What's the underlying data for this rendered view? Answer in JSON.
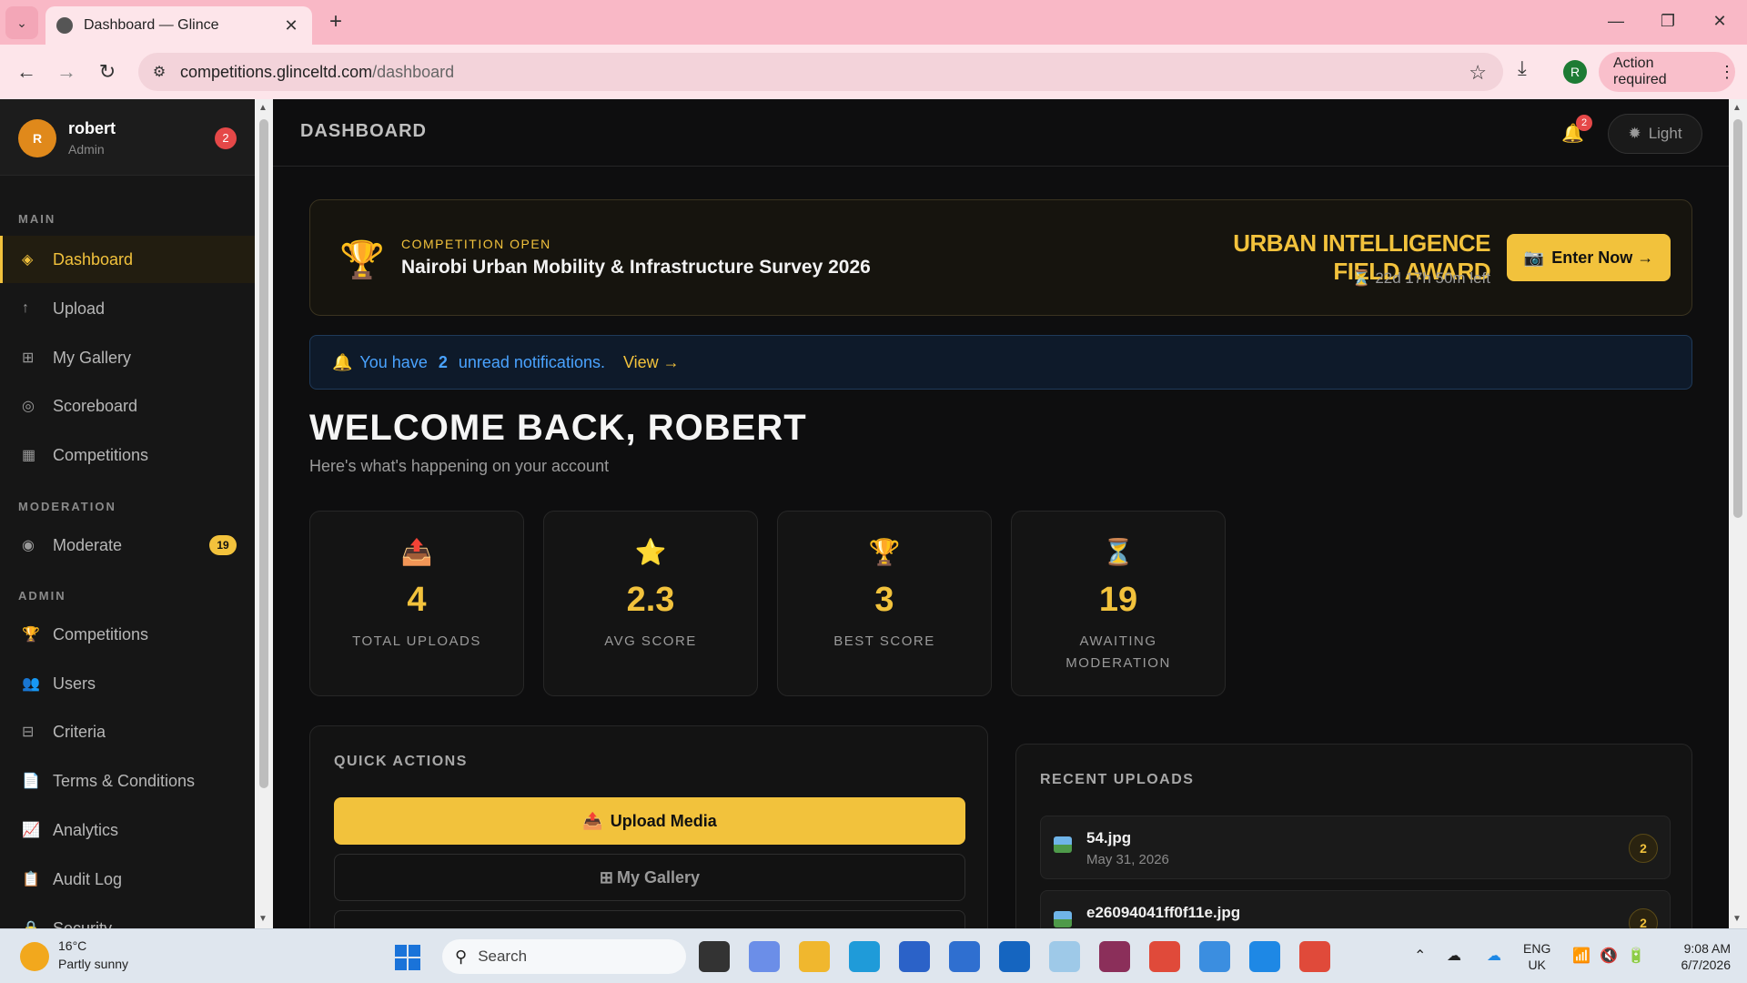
{
  "browser": {
    "tab_title": "Dashboard — Glince",
    "url_host": "competitions.glinceltd.com",
    "url_path": "/dashboard",
    "profile_initial": "R",
    "action_required": "Action required"
  },
  "sidebar": {
    "user": {
      "initial": "R",
      "name": "robert",
      "role": "Admin",
      "badge": "2"
    },
    "sections": {
      "main": "MAIN",
      "moderation": "MODERATION",
      "admin": "ADMIN"
    },
    "items": [
      {
        "label": "Dashboard",
        "icon": "diamond-icon",
        "glyph": "◈"
      },
      {
        "label": "Upload",
        "icon": "arrow-up-icon",
        "glyph": "↑"
      },
      {
        "label": "My Gallery",
        "icon": "grid-icon",
        "glyph": "⊞"
      },
      {
        "label": "Scoreboard",
        "icon": "target-icon",
        "glyph": "◎"
      },
      {
        "label": "Competitions",
        "icon": "checkered-flag-icon",
        "glyph": "▦"
      },
      {
        "label": "Moderate",
        "icon": "radio-icon",
        "glyph": "◉",
        "badge": "19"
      },
      {
        "label": "Competitions",
        "icon": "trophy-icon",
        "glyph": "🏆"
      },
      {
        "label": "Users",
        "icon": "users-icon",
        "glyph": "👥"
      },
      {
        "label": "Criteria",
        "icon": "list-icon",
        "glyph": "⊟"
      },
      {
        "label": "Terms & Conditions",
        "icon": "document-icon",
        "glyph": "📄"
      },
      {
        "label": "Analytics",
        "icon": "chart-icon",
        "glyph": "📈"
      },
      {
        "label": "Audit Log",
        "icon": "log-icon",
        "glyph": "📋"
      },
      {
        "label": "Security",
        "icon": "lock-icon",
        "glyph": "🔒"
      }
    ]
  },
  "header": {
    "title": "DASHBOARD",
    "notification_count": "2",
    "theme_label": "Light"
  },
  "competition": {
    "status": "COMPETITION OPEN",
    "name": "Nairobi Urban Mobility & Infrastructure Survey 2026",
    "award": "URBAN INTELLIGENCE FIELD AWARD",
    "time_left": "22d 17h 50m left",
    "cta": "Enter Now →"
  },
  "notification_bar": {
    "prefix": "You have",
    "count": "2",
    "suffix": "unread notifications.",
    "link": "View →"
  },
  "welcome": {
    "title": "WELCOME BACK, ROBERT",
    "subtitle": "Here's what's happening on your account"
  },
  "stats": [
    {
      "icon": "inbox-upload-icon",
      "glyph": "📤",
      "value": "4",
      "label": "TOTAL UPLOADS"
    },
    {
      "icon": "star-icon",
      "glyph": "⭐",
      "value": "2.3",
      "label": "AVG SCORE"
    },
    {
      "icon": "trophy-icon",
      "glyph": "🏆",
      "value": "3",
      "label": "BEST SCORE"
    },
    {
      "icon": "hourglass-icon",
      "glyph": "⏳",
      "value": "19",
      "label": "AWAITING MODERATION"
    }
  ],
  "quick_actions": {
    "title": "QUICK ACTIONS",
    "upload": "Upload Media",
    "gallery": "My Gallery"
  },
  "recent_uploads": {
    "title": "RECENT UPLOADS",
    "items": [
      {
        "name": "54.jpg",
        "date": "May 31, 2026",
        "score": "2"
      },
      {
        "name": "e26094041ff0f11e.jpg",
        "date": "",
        "score": "2"
      }
    ]
  },
  "taskbar": {
    "temp": "16°C",
    "weather": "Partly sunny",
    "search": "Search",
    "lang1": "ENG",
    "lang2": "UK",
    "time": "9:08 AM",
    "date": "6/7/2026"
  },
  "colors": {
    "accent": "#f2c23c",
    "danger": "#e54848",
    "info": "#4aa3ff"
  }
}
